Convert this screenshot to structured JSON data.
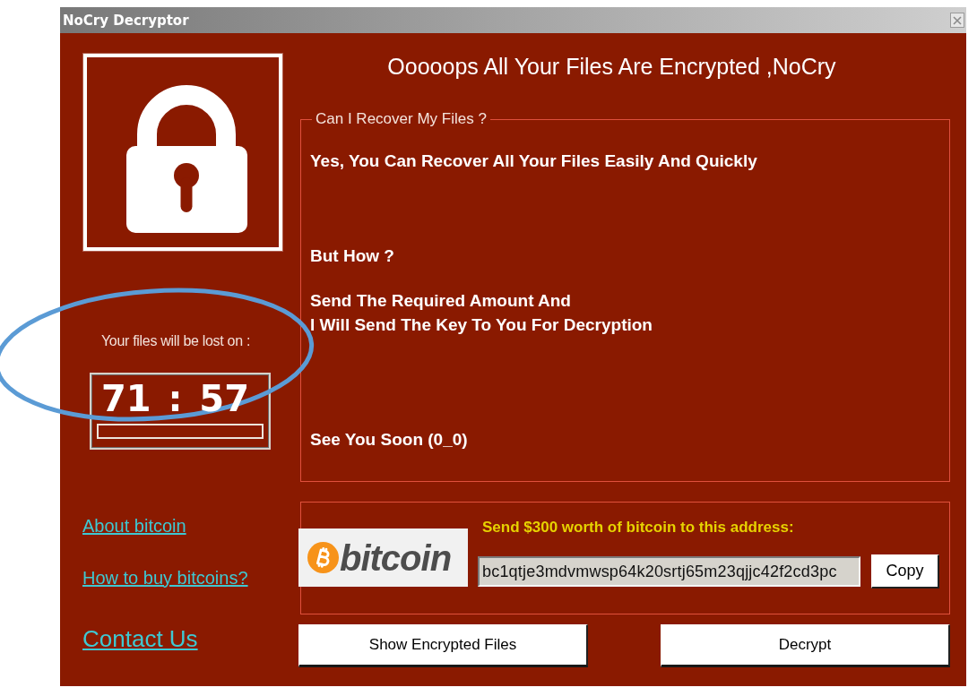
{
  "window": {
    "title": "NoCry Decryptor"
  },
  "countdown": {
    "label": "Your files will be lost on :",
    "hours": "71",
    "separator": ":",
    "minutes": "57"
  },
  "links": [
    {
      "label": "About bitcoin",
      "kind": "small"
    },
    {
      "label": "How to buy bitcoins?",
      "kind": "small"
    },
    {
      "label": "Contact Us",
      "kind": "large"
    }
  ],
  "heading": "Ooooops All Your Files Are Encrypted ,NoCry",
  "recover_group": {
    "legend": "Can I Recover My Files ?",
    "paragraphs": [
      "Yes, You Can Recover All Your Files Easily And Quickly",
      "But How ?",
      "Send The Required Amount And\nI Will Send The Key To You For Decryption",
      "See You Soon (0_0)"
    ]
  },
  "payment": {
    "logo_text": "bitcoin",
    "instruction": "Send $300 worth of bitcoin to this address:",
    "address": "bc1qtje3mdvmwsp64k20srtj65m23qjjc42f2cd3pc",
    "copy_button": "Copy"
  },
  "buttons": [
    "Show Encrypted Files",
    "Decrypt"
  ]
}
